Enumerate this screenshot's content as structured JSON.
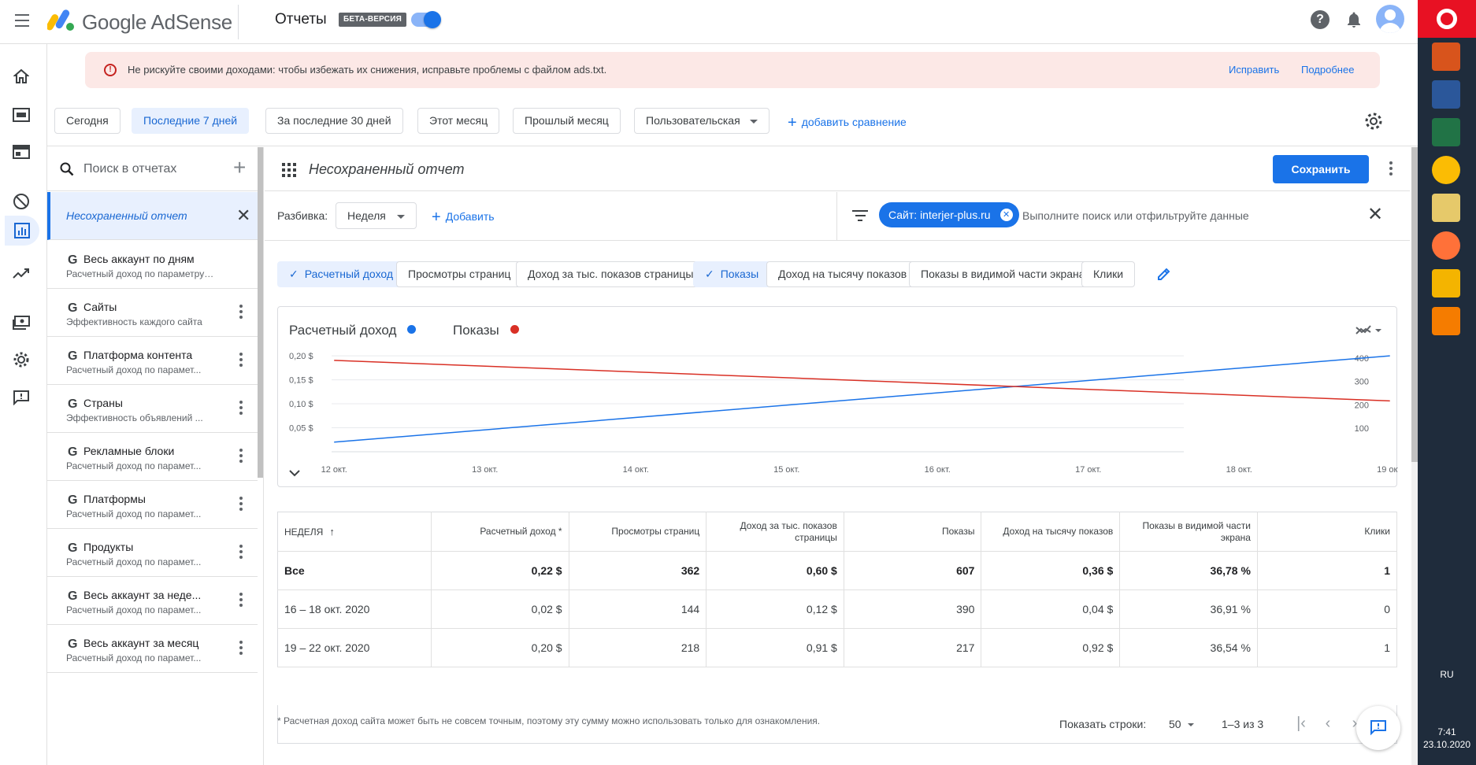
{
  "topbar": {
    "brand": "Google AdSense",
    "title": "Отчеты",
    "beta": "БЕТА-ВЕРСИЯ"
  },
  "alert": {
    "icon_text": "!",
    "text": "Не рискуйте своими доходами: чтобы избежать их снижения, исправьте проблемы с файлом ads.txt.",
    "fix": "Исправить",
    "more": "Подробнее"
  },
  "dates": {
    "chips": [
      "Сегодня",
      "Последние 7 дней",
      "За последние 30 дней",
      "Этот месяц",
      "Прошлый месяц",
      "Пользовательская"
    ],
    "selected": "Последние 7 дней",
    "add_compare": "добавить сравнение"
  },
  "reports": {
    "search_placeholder": "Поиск в отчетах",
    "active": "Несохраненный отчет",
    "items": [
      {
        "name": "Весь аккаунт по дням",
        "sub": "Расчетный доход по параметру \"Дат..."
      },
      {
        "name": "Сайты",
        "sub": "Эффективность каждого сайта"
      },
      {
        "name": "Платформа контента",
        "sub": "Расчетный доход по парамет..."
      },
      {
        "name": "Страны",
        "sub": "Эффективность объявлений ..."
      },
      {
        "name": "Рекламные блоки",
        "sub": "Расчетный доход по парамет..."
      },
      {
        "name": "Платформы",
        "sub": "Расчетный доход по парамет..."
      },
      {
        "name": "Продукты",
        "sub": "Расчетный доход по парамет..."
      },
      {
        "name": "Весь аккаунт за неде...",
        "sub": "Расчетный доход по парамет..."
      },
      {
        "name": "Весь аккаунт за месяц",
        "sub": "Расчетный доход по парамет..."
      }
    ]
  },
  "main": {
    "title": "Несохраненный отчет",
    "save": "Сохранить",
    "breakdown_label": "Разбивка:",
    "breakdown_value": "Неделя",
    "add": "Добавить",
    "filter_chip": "Сайт: interjer-plus.ru",
    "filter_placeholder": "Выполните поиск или отфильтруйте данные",
    "metrics": [
      {
        "label": "Расчетный доход",
        "selected": true
      },
      {
        "label": "Просмотры страниц",
        "selected": false
      },
      {
        "label": "Доход за тыс. показов страницы",
        "selected": false
      },
      {
        "label": "Показы",
        "selected": true
      },
      {
        "label": "Доход на тысячу показов",
        "selected": false
      },
      {
        "label": "Показы в видимой части экрана",
        "selected": false
      },
      {
        "label": "Клики",
        "selected": false
      }
    ],
    "footnote": "* Расчетная доход сайта может быть не совсем точным, поэтому эту сумму можно использовать только для ознакомления."
  },
  "chart_data": {
    "type": "line",
    "x": [
      "12 окт.",
      "13 окт.",
      "14 окт.",
      "15 окт.",
      "16 окт.",
      "17 окт.",
      "18 окт.",
      "19 окт."
    ],
    "series": [
      {
        "name": "Расчетный доход",
        "axis": "left",
        "color": "#1a73e8",
        "points": [
          [
            0,
            0.02
          ],
          [
            7,
            0.2
          ]
        ]
      },
      {
        "name": "Показы",
        "axis": "right",
        "color": "#d93025",
        "points": [
          [
            0,
            390
          ],
          [
            7,
            217
          ]
        ]
      }
    ],
    "y_left": {
      "ticks": [
        "0,05 $",
        "0,10 $",
        "0,15 $",
        "0,20 $"
      ],
      "values": [
        0.05,
        0.1,
        0.15,
        0.2
      ],
      "range": [
        0,
        0.21
      ]
    },
    "y_right": {
      "ticks": [
        "100",
        "200",
        "300",
        "400"
      ],
      "values": [
        100,
        200,
        300,
        400
      ],
      "range": [
        0,
        430
      ]
    },
    "grid": true
  },
  "table": {
    "headers": [
      "НЕДЕЛЯ",
      "Расчетный доход *",
      "Просмотры страниц",
      "Доход за тыс. показов страницы",
      "Показы",
      "Доход на тысячу показов",
      "Показы в видимой части экрана",
      "Клики"
    ],
    "sort_icon": "↑",
    "rows": [
      [
        "Все",
        "0,22 $",
        "362",
        "0,60 $",
        "607",
        "0,36 $",
        "36,78 %",
        "1"
      ],
      [
        "16 – 18 окт. 2020",
        "0,02 $",
        "144",
        "0,12 $",
        "390",
        "0,04 $",
        "36,91 %",
        "0"
      ],
      [
        "19 – 22 окт. 2020",
        "0,20 $",
        "218",
        "0,91 $",
        "217",
        "0,92 $",
        "36,54 %",
        "1"
      ]
    ]
  },
  "pager": {
    "label": "Показать строки:",
    "value": "50",
    "range": "1–3 из 3"
  },
  "taskbar": {
    "lang": "RU",
    "time": "7:41",
    "date": "23.10.2020"
  }
}
